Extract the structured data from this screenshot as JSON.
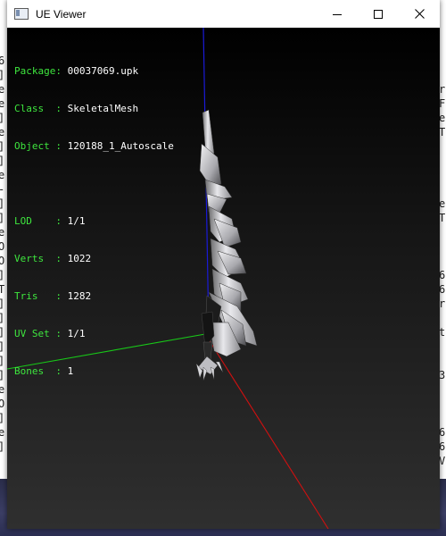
{
  "window": {
    "title": "UE Viewer",
    "controls": {
      "minimize": "minimize-icon",
      "maximize": "maximize-icon",
      "close": "close-icon"
    }
  },
  "background_text": {
    "left": [
      "6",
      "]",
      "e",
      "e",
      "]",
      "e",
      "]",
      "]",
      "e",
      "-",
      "]",
      "]",
      "e",
      "O",
      "O",
      "]",
      "T",
      "]",
      "]",
      "]",
      "]",
      "]",
      "]",
      "e",
      "O",
      "]",
      "e",
      "]"
    ],
    "right": [
      "",
      "",
      "r",
      "F",
      "e",
      "T",
      "",
      "",
      "",
      "",
      "e",
      "T",
      "",
      "",
      "",
      "6",
      "6",
      "r",
      "",
      "t",
      "",
      "",
      "3",
      "",
      "",
      "",
      "6",
      "6",
      "V"
    ]
  },
  "info_panel": {
    "object_info": [
      {
        "key": "Package",
        "sep": ": ",
        "value": "00037069.upk"
      },
      {
        "key": "Class  ",
        "sep": ": ",
        "value": "SkeletalMesh"
      },
      {
        "key": "Object ",
        "sep": ": ",
        "value": "120188_1_Autoscale"
      }
    ],
    "mesh_stats": [
      {
        "key": "LOD    ",
        "sep": ": ",
        "value": "1/1"
      },
      {
        "key": "Verts  ",
        "sep": ": ",
        "value": "1022"
      },
      {
        "key": "Tris   ",
        "sep": ": ",
        "value": "1282"
      },
      {
        "key": "UV Set ",
        "sep": ": ",
        "value": "1/1"
      },
      {
        "key": "Bones  ",
        "sep": ": ",
        "value": "1"
      }
    ]
  },
  "colors": {
    "label": "#3ee63e",
    "value": "#ffffff",
    "axis_x": "#d01010",
    "axis_y": "#18c818",
    "axis_z": "#1a1ad8"
  }
}
